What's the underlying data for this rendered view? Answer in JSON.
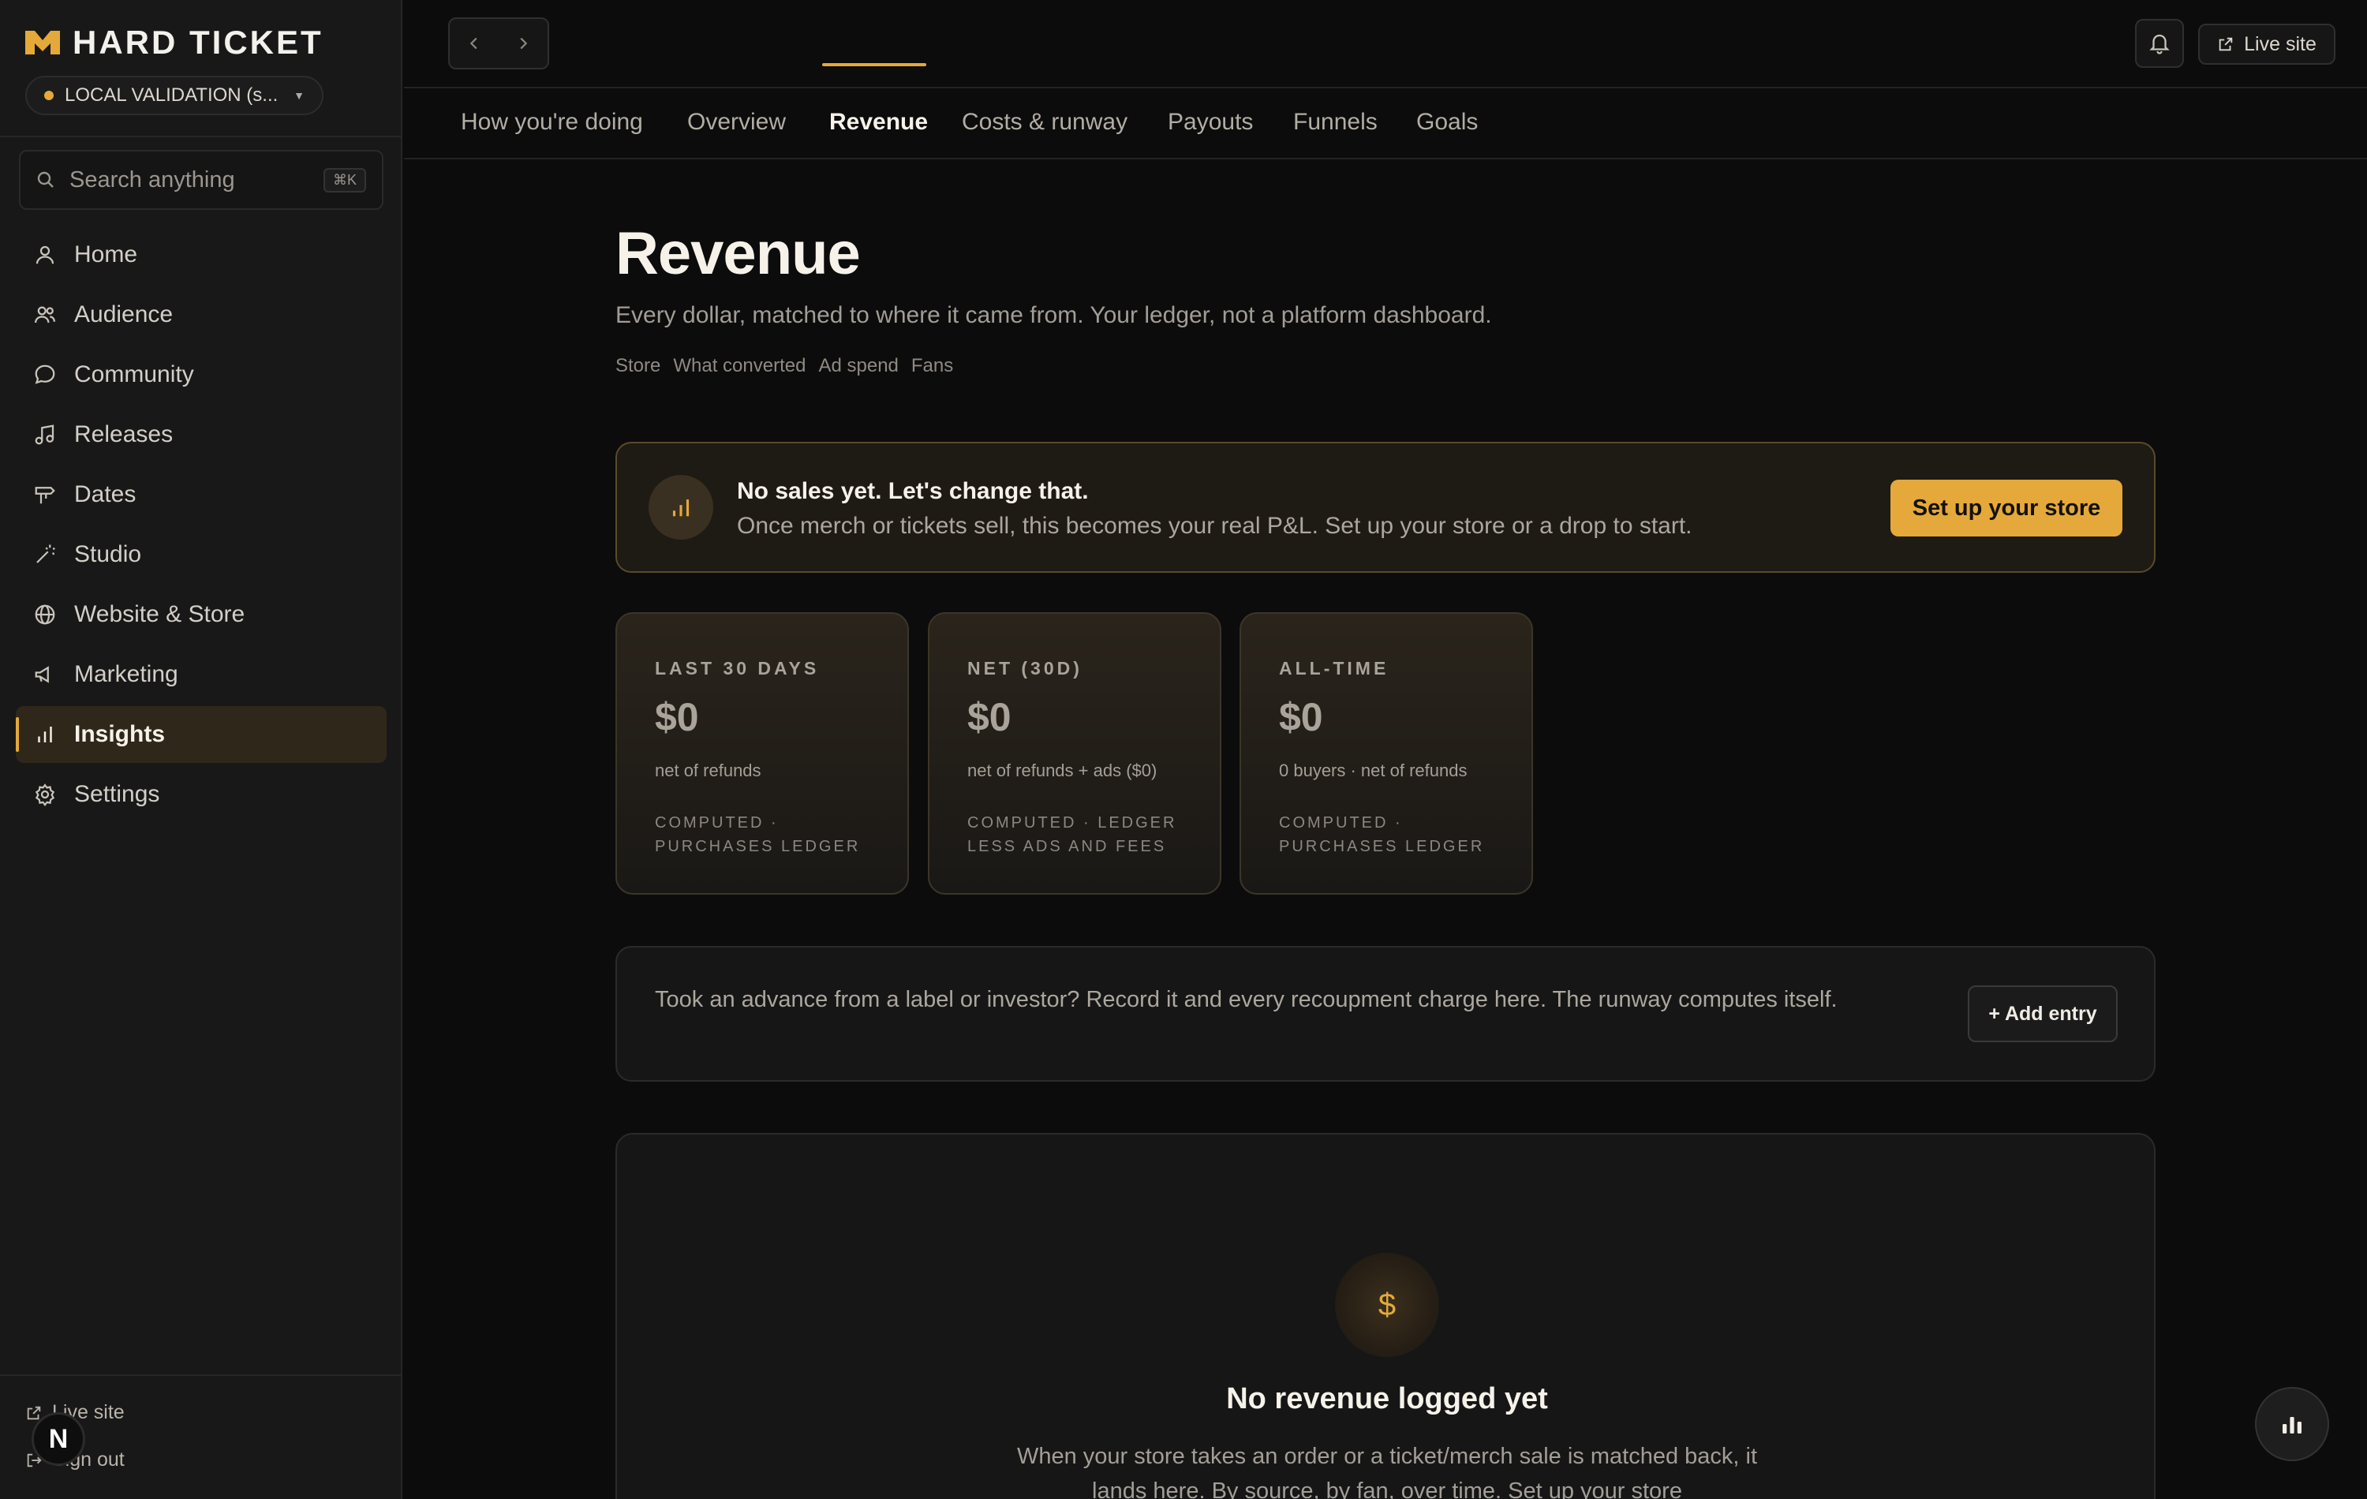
{
  "brand": {
    "name": "HARD TICKET",
    "accent": "#e4a93a"
  },
  "workspace": {
    "label": "LOCAL VALIDATION (s..."
  },
  "search": {
    "placeholder": "Search anything",
    "shortcut": "⌘K"
  },
  "sidebar": {
    "items": [
      {
        "label": "Home",
        "icon": "user-icon"
      },
      {
        "label": "Audience",
        "icon": "users-icon"
      },
      {
        "label": "Community",
        "icon": "chat-bubble-icon"
      },
      {
        "label": "Releases",
        "icon": "music-note-icon"
      },
      {
        "label": "Dates",
        "icon": "signpost-icon"
      },
      {
        "label": "Studio",
        "icon": "magic-wand-icon"
      },
      {
        "label": "Website & Store",
        "icon": "globe-icon"
      },
      {
        "label": "Marketing",
        "icon": "megaphone-icon"
      },
      {
        "label": "Insights",
        "icon": "bar-chart-icon",
        "active": true
      },
      {
        "label": "Settings",
        "icon": "gear-icon"
      }
    ],
    "footer": {
      "live_site": "Live site",
      "sign_out": "Sign out",
      "avatar_letter": "N"
    }
  },
  "topbar": {
    "live_site": "Live site"
  },
  "tabs": [
    {
      "label": "How you're doing"
    },
    {
      "label": "Overview"
    },
    {
      "label": "Revenue",
      "active": true
    },
    {
      "label": "Costs & runway"
    },
    {
      "label": "Payouts"
    },
    {
      "label": "Funnels"
    },
    {
      "label": "Goals"
    }
  ],
  "page": {
    "title": "Revenue",
    "subtitle": "Every dollar, matched to where it came from. Your ledger, not a platform dashboard.",
    "chips": [
      "Store",
      "What converted",
      "Ad spend",
      "Fans"
    ]
  },
  "banner": {
    "title": "No sales yet. Let's change that.",
    "text": "Once merch or tickets sell, this becomes your real P&L. Set up your store or a drop to start.",
    "button": "Set up your store"
  },
  "kpis": [
    {
      "label": "LAST 30 DAYS",
      "value": "$0",
      "note": "net of refunds",
      "source": "COMPUTED · PURCHASES LEDGER"
    },
    {
      "label": "NET (30D)",
      "value": "$0",
      "note": "net of refunds + ads ($0)",
      "source": "COMPUTED · LEDGER LESS ADS AND FEES"
    },
    {
      "label": "ALL-TIME",
      "value": "$0",
      "note": "0 buyers · net of refunds",
      "source": "COMPUTED · PURCHASES LEDGER"
    }
  ],
  "advance": {
    "text": "Took an advance from a label or investor? Record it and every recoupment charge here. The runway computes itself.",
    "button": "+ Add entry"
  },
  "empty_state": {
    "icon": "$",
    "title": "No revenue logged yet",
    "text": "When your store takes an order or a ticket/merch sale is matched back, it lands here. By source, by fan, over time. Set up your store"
  }
}
